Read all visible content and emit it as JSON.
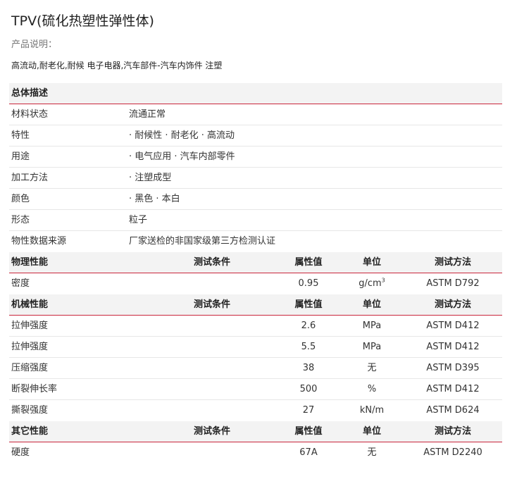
{
  "title": "TPV(硫化热塑性弹性体)",
  "description_label": "产品说明：",
  "description_text": "高流动,耐老化,耐候 电子电器,汽车部件-汽车内饰件 注塑",
  "overview": {
    "section_title": "总体描述",
    "rows": [
      {
        "name": "材料状态",
        "value": "流通正常"
      },
      {
        "name": "特性",
        "value": "· 耐候性 · 耐老化 · 高流动"
      },
      {
        "name": "用途",
        "value": "· 电气应用 · 汽车内部零件"
      },
      {
        "name": "加工方法",
        "value": "· 注塑成型"
      },
      {
        "name": "颜色",
        "value": "· 黑色 · 本白"
      },
      {
        "name": "形态",
        "value": "粒子"
      },
      {
        "name": "物性数据来源",
        "value": "厂家送检的非国家级第三方检测认证"
      }
    ]
  },
  "physical": {
    "section_title": "物理性能",
    "col_condition": "测试条件",
    "col_value": "属性值",
    "col_unit": "单位",
    "col_method": "测试方法",
    "rows": [
      {
        "name": "密度",
        "condition": "",
        "value": "0.95",
        "unit": "g/cm",
        "unit_sup": "3",
        "method": "ASTM D792"
      }
    ]
  },
  "mechanical": {
    "section_title": "机械性能",
    "col_condition": "测试条件",
    "col_value": "属性值",
    "col_unit": "单位",
    "col_method": "测试方法",
    "rows": [
      {
        "name": "拉伸强度",
        "condition": "",
        "value": "2.6",
        "unit": "MPa",
        "method": "ASTM D412"
      },
      {
        "name": "拉伸强度",
        "condition": "",
        "value": "5.5",
        "unit": "MPa",
        "method": "ASTM D412"
      },
      {
        "name": "压缩强度",
        "condition": "",
        "value": "38",
        "unit": "无",
        "method": "ASTM D395"
      },
      {
        "name": "断裂伸长率",
        "condition": "",
        "value": "500",
        "unit": "%",
        "method": "ASTM D412"
      },
      {
        "name": "撕裂强度",
        "condition": "",
        "value": "27",
        "unit": "kN/m",
        "method": "ASTM D624"
      }
    ]
  },
  "other": {
    "section_title": "其它性能",
    "col_condition": "测试条件",
    "col_value": "属性值",
    "col_unit": "单位",
    "col_method": "测试方法",
    "rows": [
      {
        "name": "硬度",
        "condition": "",
        "value": "67A",
        "unit": "无",
        "method": "ASTM D2240"
      }
    ]
  }
}
